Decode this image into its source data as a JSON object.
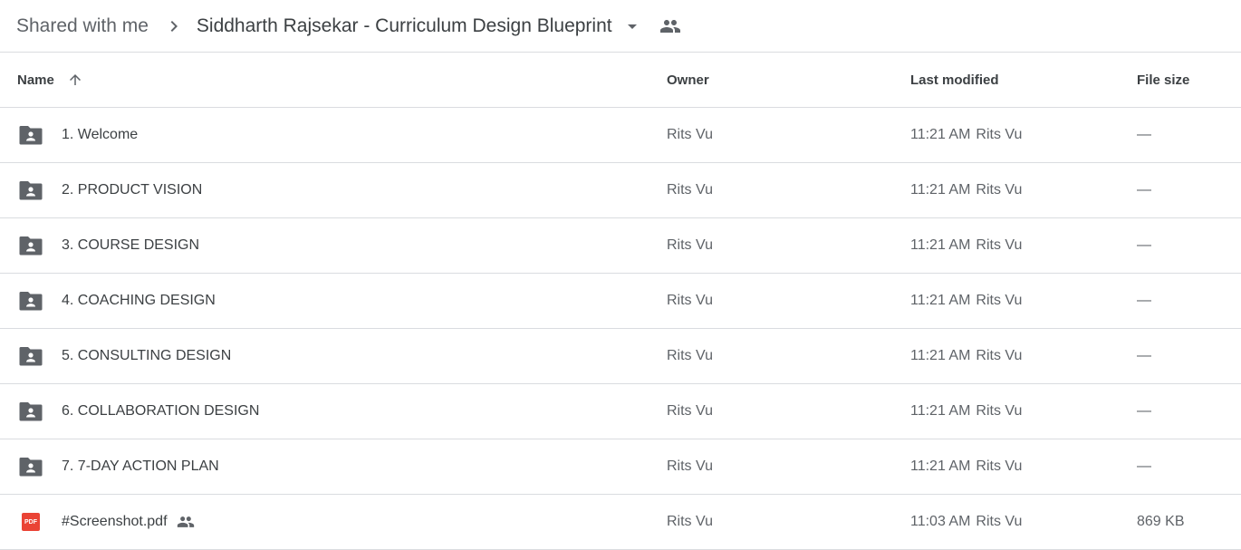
{
  "breadcrumb": {
    "root": "Shared with me",
    "current": "Siddharth Rajsekar - Curriculum Design Blueprint"
  },
  "icons": {
    "breadcrumb_separator": "chevron-right-icon",
    "folder_menu": "caret-down-icon",
    "shared": "people-icon",
    "sort": "arrow-up-icon",
    "shared_folder": "shared-folder-icon",
    "pdf": "pdf-icon"
  },
  "table": {
    "headers": {
      "name": "Name",
      "owner": "Owner",
      "last_modified": "Last modified",
      "file_size": "File size"
    },
    "sort": {
      "column": "name",
      "direction": "ascending"
    },
    "rows": [
      {
        "type": "shared-folder",
        "name": "1. Welcome",
        "owner": "Rits Vu",
        "modified_time": "11:21 AM",
        "modified_by": "Rits Vu",
        "size": "—",
        "shared": false
      },
      {
        "type": "shared-folder",
        "name": "2. PRODUCT VISION",
        "owner": "Rits Vu",
        "modified_time": "11:21 AM",
        "modified_by": "Rits Vu",
        "size": "—",
        "shared": false
      },
      {
        "type": "shared-folder",
        "name": "3. COURSE DESIGN",
        "owner": "Rits Vu",
        "modified_time": "11:21 AM",
        "modified_by": "Rits Vu",
        "size": "—",
        "shared": false
      },
      {
        "type": "shared-folder",
        "name": "4. COACHING DESIGN",
        "owner": "Rits Vu",
        "modified_time": "11:21 AM",
        "modified_by": "Rits Vu",
        "size": "—",
        "shared": false
      },
      {
        "type": "shared-folder",
        "name": "5. CONSULTING DESIGN",
        "owner": "Rits Vu",
        "modified_time": "11:21 AM",
        "modified_by": "Rits Vu",
        "size": "—",
        "shared": false
      },
      {
        "type": "shared-folder",
        "name": "6. COLLABORATION DESIGN",
        "owner": "Rits Vu",
        "modified_time": "11:21 AM",
        "modified_by": "Rits Vu",
        "size": "—",
        "shared": false
      },
      {
        "type": "shared-folder",
        "name": "7. 7-DAY ACTION PLAN",
        "owner": "Rits Vu",
        "modified_time": "11:21 AM",
        "modified_by": "Rits Vu",
        "size": "—",
        "shared": false
      },
      {
        "type": "pdf",
        "name": "#Screenshot.pdf",
        "owner": "Rits Vu",
        "modified_time": "11:03 AM",
        "modified_by": "Rits Vu",
        "size": "869 KB",
        "shared": true,
        "badge": "PDF"
      }
    ]
  },
  "colors": {
    "folder_icon": "#5f6368",
    "pdf_red": "#ea4335",
    "divider": "#dadce0",
    "text_primary": "#3c4043",
    "text_secondary": "#5f6368"
  }
}
